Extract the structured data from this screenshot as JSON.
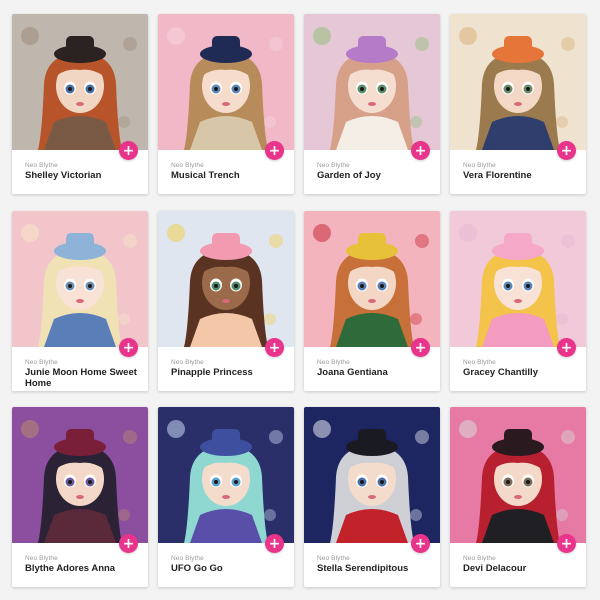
{
  "accent_color": "#e8348b",
  "add_button_symbol": "+",
  "add_button_icon": "plus-icon",
  "products": [
    {
      "series": "Neo Blythe",
      "name": "Shelley Victorian",
      "colors": {
        "bg": "#bfb7ad",
        "hair": "#b8542a",
        "skin": "#f2d6c4",
        "outfit": "#7a5a45",
        "hat": "#2b2222",
        "eye": "#4b6fa0",
        "accent": "#9c8c7c"
      }
    },
    {
      "series": "Neo Blythe",
      "name": "Musical Trench",
      "colors": {
        "bg": "#f1b9c8",
        "hair": "#b78c5a",
        "skin": "#f6dccb",
        "outfit": "#d8c6a8",
        "hat": "#1f2a55",
        "eye": "#5b86b5",
        "accent": "#f7d3de"
      }
    },
    {
      "series": "Neo Blythe",
      "name": "Garden of Joy",
      "colors": {
        "bg": "#e6c7d6",
        "hair": "#d7a089",
        "skin": "#f5ddd0",
        "outfit": "#f4eee6",
        "hat": "#b57bc9",
        "eye": "#5a8c6a",
        "accent": "#8fbf7a"
      }
    },
    {
      "series": "Neo Blythe",
      "name": "Vera Florentine",
      "colors": {
        "bg": "#efe3cf",
        "hair": "#9b7a4d",
        "skin": "#f3d8c5",
        "outfit": "#2f3e6d",
        "hat": "#e6753a",
        "eye": "#6a8a6a",
        "accent": "#d8b07a"
      }
    },
    {
      "series": "Neo Blythe",
      "name": "Junie Moon Home Sweet Home",
      "colors": {
        "bg": "#f2c5cb",
        "hair": "#f1e2b5",
        "skin": "#f8e1d5",
        "outfit": "#5a7fb8",
        "hat": "#8fb2d8",
        "eye": "#6f8fb0",
        "accent": "#f7e4c8"
      }
    },
    {
      "series": "Neo Blythe",
      "name": "Pinapple Princess",
      "colors": {
        "bg": "#dfe6ef",
        "hair": "#5a3322",
        "skin": "#9a6a4a",
        "outfit": "#f4c7a8",
        "hat": "#f29ab0",
        "eye": "#4f8a6a",
        "accent": "#f3cf52"
      }
    },
    {
      "series": "Neo Blythe",
      "name": "Joana Gentiana",
      "colors": {
        "bg": "#f4b4bd",
        "hair": "#c8703a",
        "skin": "#f3d7c4",
        "outfit": "#2f6b3a",
        "hat": "#e8c13a",
        "eye": "#5b7fb5",
        "accent": "#c72b3a"
      }
    },
    {
      "series": "Neo Blythe",
      "name": "Gracey Chantilly",
      "colors": {
        "bg": "#f1c9d8",
        "hair": "#f3c34a",
        "skin": "#f8e1d5",
        "outfit": "#f39bc0",
        "hat": "#f6a8c8",
        "eye": "#5a86b5",
        "accent": "#e6b7d2"
      }
    },
    {
      "series": "Neo Blythe",
      "name": "Blythe Adores Anna",
      "colors": {
        "bg": "#8c4fa0",
        "hair": "#2b2236",
        "skin": "#f3d8c8",
        "outfit": "#5a2a3a",
        "hat": "#7a1f38",
        "eye": "#6a5a9a",
        "accent": "#b98a6a"
      }
    },
    {
      "series": "Neo Blythe",
      "name": "UFO Go Go",
      "colors": {
        "bg": "#2a2f6a",
        "hair": "#8fd8d2",
        "skin": "#f4dccd",
        "outfit": "#5a4fa8",
        "hat": "#3f4fa0",
        "eye": "#5aa0c8",
        "accent": "#c8d8f0"
      }
    },
    {
      "series": "Neo Blythe",
      "name": "Stella Serendipitous",
      "colors": {
        "bg": "#1d2660",
        "hair": "#cfcfd6",
        "skin": "#f4dccd",
        "outfit": "#c2232b",
        "hat": "#1a1a22",
        "eye": "#4a6fa8",
        "accent": "#e8e8f4"
      }
    },
    {
      "series": "Neo Blythe",
      "name": "Devi Delacour",
      "colors": {
        "bg": "#e77aa4",
        "hair": "#b8202f",
        "skin": "#f4d8c8",
        "outfit": "#1f1f24",
        "hat": "#2a1a1f",
        "eye": "#7a6a5a",
        "accent": "#d8d8d8"
      }
    }
  ]
}
